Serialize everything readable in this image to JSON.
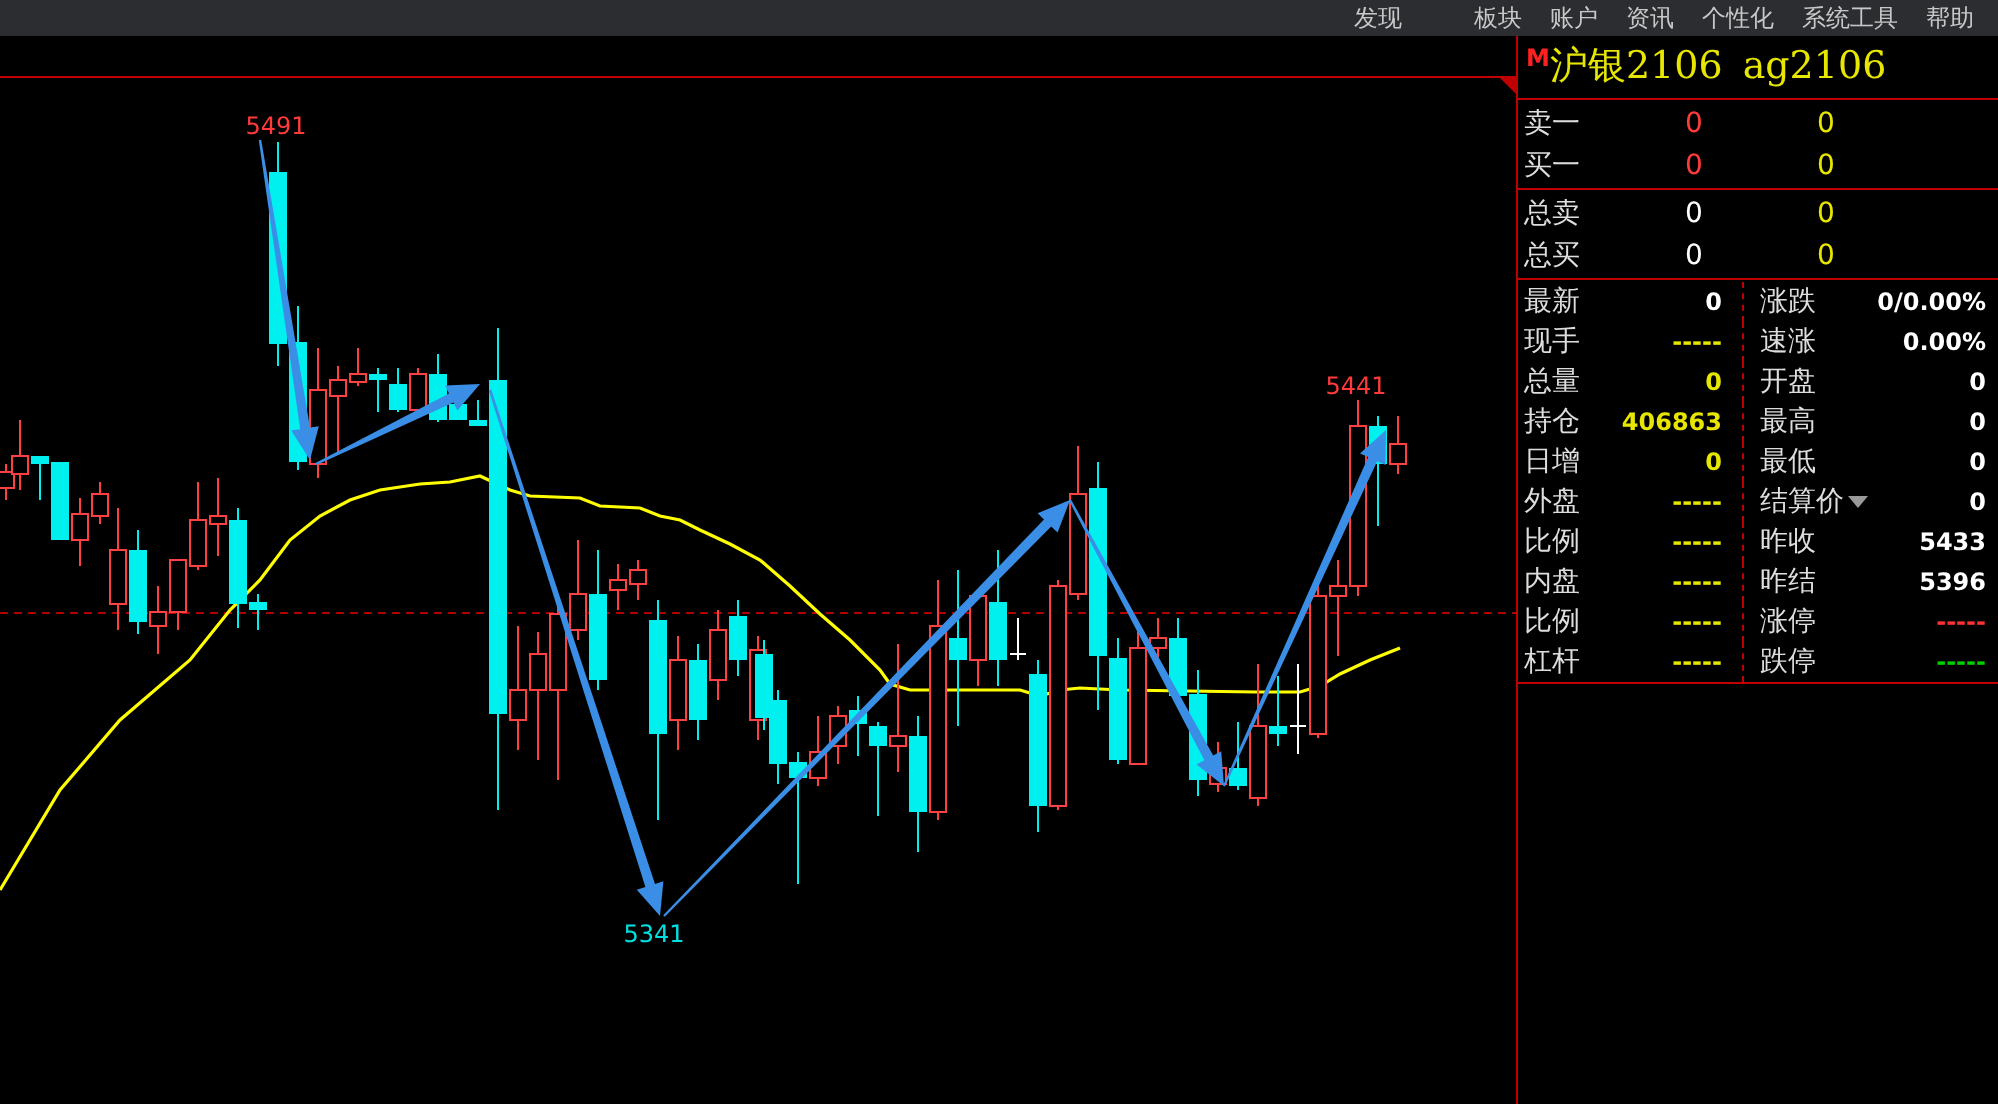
{
  "menu": [
    "发现",
    "板块",
    "账户",
    "资讯",
    "个性化",
    "系统工具",
    "帮助"
  ],
  "chart": {
    "annotations": [
      {
        "text": "5491",
        "kind": "high"
      },
      {
        "text": "5341",
        "kind": "low"
      },
      {
        "text": "5441",
        "kind": "high"
      }
    ]
  },
  "quote": {
    "badge": "M",
    "name": "沪银2106",
    "code": "ag2106",
    "depth": [
      {
        "label": "卖一",
        "price": "0",
        "volume": "0",
        "kind": "level"
      },
      {
        "label": "买一",
        "price": "0",
        "volume": "0",
        "kind": "level"
      }
    ],
    "totals": [
      {
        "label": "总卖",
        "price": "0",
        "volume": "0",
        "kind": "total"
      },
      {
        "label": "总买",
        "price": "0",
        "volume": "0",
        "kind": "total"
      }
    ],
    "stats": [
      {
        "left": {
          "label": "最新",
          "value": "0",
          "color": "#ffffff"
        },
        "right": {
          "label": "涨跌",
          "value": "0/0.00%",
          "color": "#ffffff",
          "kind": "plain"
        }
      },
      {
        "left": {
          "label": "现手",
          "value": "-----",
          "color": "#e6e600"
        },
        "right": {
          "label": "速涨",
          "value": "0.00%",
          "color": "#ffffff",
          "kind": "plain"
        }
      },
      {
        "left": {
          "label": "总量",
          "value": "0",
          "color": "#e6e600"
        },
        "right": {
          "label": "开盘",
          "value": "0",
          "color": "#ffffff",
          "kind": "plain"
        }
      },
      {
        "left": {
          "label": "持仓",
          "value": "406863",
          "color": "#e6e600"
        },
        "right": {
          "label": "最高",
          "value": "0",
          "color": "#ffffff",
          "kind": "plain"
        }
      },
      {
        "left": {
          "label": "日增",
          "value": "0",
          "color": "#e6e600"
        },
        "right": {
          "label": "最低",
          "value": "0",
          "color": "#ffffff",
          "kind": "plain"
        }
      },
      {
        "left": {
          "label": "外盘",
          "value": "-----",
          "color": "#e6e600"
        },
        "right": {
          "label": "结算价",
          "value": "0",
          "color": "#ffffff",
          "kind": "menu"
        }
      },
      {
        "left": {
          "label": "比例",
          "value": "-----",
          "color": "#e6e600"
        },
        "right": {
          "label": "昨收",
          "value": "5433",
          "color": "#ffffff",
          "kind": "plain"
        }
      },
      {
        "left": {
          "label": "内盘",
          "value": "-----",
          "color": "#e6e600"
        },
        "right": {
          "label": "昨结",
          "value": "5396",
          "color": "#ffffff",
          "kind": "plain"
        }
      },
      {
        "left": {
          "label": "比例",
          "value": "-----",
          "color": "#e6e600"
        },
        "right": {
          "label": "涨停",
          "value": "-----",
          "color": "#ff3232",
          "kind": "plain"
        }
      },
      {
        "left": {
          "label": "杠杆",
          "value": "-----",
          "color": "#e6e600"
        },
        "right": {
          "label": "跌停",
          "value": "-----",
          "color": "#00d000",
          "kind": "plain"
        }
      }
    ]
  }
}
